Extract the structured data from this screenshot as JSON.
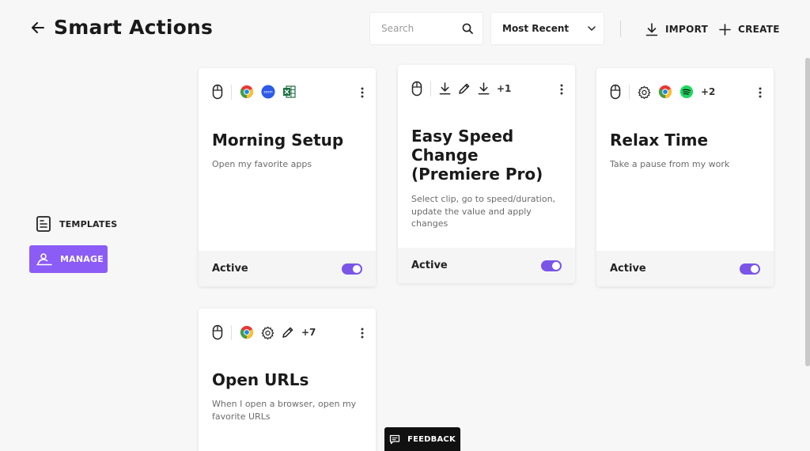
{
  "header": {
    "title": "Smart Actions",
    "search_placeholder": "Search",
    "sort_value": "Most Recent",
    "import_label": "IMPORT",
    "create_label": "CREATE"
  },
  "sidebar": {
    "items": [
      {
        "label": "TEMPLATES",
        "icon": "templates-icon",
        "active": false
      },
      {
        "label": "MANAGE",
        "icon": "manage-icon",
        "active": true
      }
    ]
  },
  "cards": [
    {
      "title": "Morning Setup",
      "description": "Open my favorite apps",
      "status": "Active",
      "enabled": true,
      "icons": [
        "mouse-icon",
        "chrome-icon",
        "zoom-icon",
        "excel-icon"
      ],
      "extra": ""
    },
    {
      "title": "Easy Speed Change (Premiere Pro)",
      "description": "Select clip, go to speed/duration, update the value and apply changes",
      "status": "Active",
      "enabled": true,
      "icons": [
        "mouse-icon",
        "download-icon",
        "pencil-icon",
        "download-icon"
      ],
      "extra": "+1"
    },
    {
      "title": "Relax Time",
      "description": "Take a pause from my work",
      "status": "Active",
      "enabled": true,
      "icons": [
        "mouse-icon",
        "gear-icon",
        "chrome-icon",
        "spotify-icon"
      ],
      "extra": "+2"
    },
    {
      "title": "Open URLs",
      "description": "When I open a browser, open my favorite URLs",
      "status": "",
      "enabled": true,
      "icons": [
        "mouse-icon",
        "chrome-icon",
        "gear-icon",
        "pencil-icon"
      ],
      "extra": "+7"
    }
  ],
  "zoom_icon_text": "zoom",
  "feedback_label": "FEEDBACK",
  "colors": {
    "accent": "#8b5cf6",
    "toggle": "#7a55e8",
    "background": "#f7f7f7"
  }
}
